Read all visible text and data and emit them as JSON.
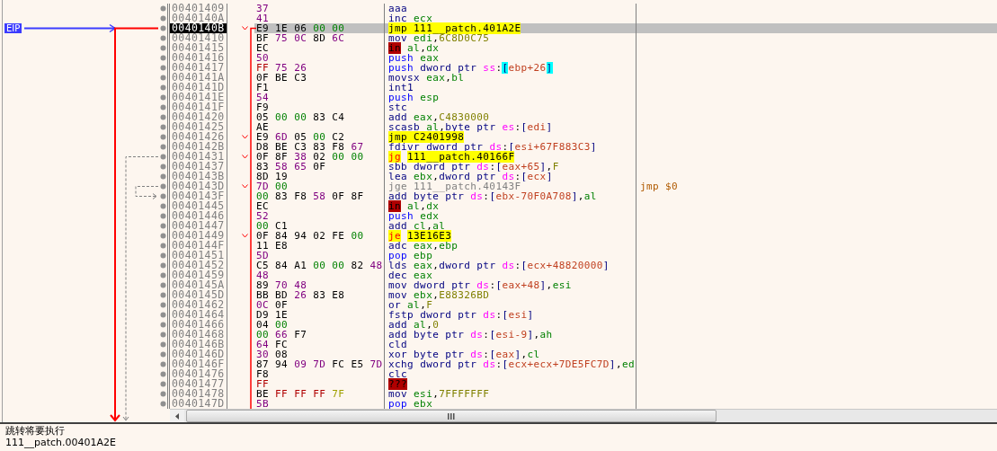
{
  "gutter": {
    "eip_label": "EIP"
  },
  "rows": [
    {
      "address": "00401409",
      "bytes": [
        {
          "text": "37",
          "kind": "p"
        }
      ],
      "branch": false,
      "selected": false,
      "instruction": [
        {
          "text": "aaa",
          "kind": "mn"
        }
      ]
    },
    {
      "address": "0040140A",
      "bytes": [
        {
          "text": "41",
          "kind": "p"
        }
      ],
      "branch": false,
      "selected": false,
      "instruction": [
        {
          "text": "inc ",
          "kind": "mn"
        },
        {
          "text": "ecx",
          "kind": "reg"
        }
      ]
    },
    {
      "address": "0040140B",
      "bytes": [
        {
          "text": "E9",
          "kind": "n"
        },
        {
          "text": "1E",
          "kind": "n"
        },
        {
          "text": "06",
          "kind": "n"
        },
        {
          "text": "00",
          "kind": "z"
        },
        {
          "text": "00",
          "kind": "z"
        }
      ],
      "branch": true,
      "selected": true,
      "instruction": [
        {
          "text": "jmp ",
          "kind": "jmp"
        },
        {
          "text": "111__patch.401A2E",
          "kind": "target"
        }
      ]
    },
    {
      "address": "00401410",
      "bytes": [
        {
          "text": "BF",
          "kind": "n"
        },
        {
          "text": "75",
          "kind": "p"
        },
        {
          "text": "0C",
          "kind": "p"
        },
        {
          "text": "8D",
          "kind": "n"
        },
        {
          "text": "6C",
          "kind": "p"
        }
      ],
      "branch": false,
      "selected": false,
      "instruction": [
        {
          "text": "mov ",
          "kind": "mn"
        },
        {
          "text": "edi",
          "kind": "reg"
        },
        {
          "text": ",",
          "kind": "punct"
        },
        {
          "text": "6C8D0C75",
          "kind": "imm"
        }
      ]
    },
    {
      "address": "00401415",
      "bytes": [
        {
          "text": "EC",
          "kind": "n"
        }
      ],
      "branch": false,
      "selected": false,
      "instruction": [
        {
          "text": "in",
          "kind": "bad"
        },
        {
          "text": "al",
          "kind": "reg"
        },
        {
          "text": ",",
          "kind": "punct"
        },
        {
          "text": "dx",
          "kind": "reg"
        }
      ]
    },
    {
      "address": "00401416",
      "bytes": [
        {
          "text": "50",
          "kind": "p"
        }
      ],
      "branch": false,
      "selected": false,
      "instruction": [
        {
          "text": "push ",
          "kind": "stack"
        },
        {
          "text": "eax",
          "kind": "reg"
        }
      ]
    },
    {
      "address": "00401417",
      "bytes": [
        {
          "text": "FF",
          "kind": "f"
        },
        {
          "text": "75",
          "kind": "p"
        },
        {
          "text": "26",
          "kind": "p"
        }
      ],
      "branch": false,
      "selected": false,
      "instruction": [
        {
          "text": "push ",
          "kind": "stack"
        },
        {
          "text": "dword ptr ",
          "kind": "size"
        },
        {
          "text": "ss",
          "kind": "seg"
        },
        {
          "text": ":",
          "kind": "punct"
        },
        {
          "text": "[",
          "kind": "hl"
        },
        {
          "text": "ebp+26",
          "kind": "mem"
        },
        {
          "text": "]",
          "kind": "hl"
        }
      ]
    },
    {
      "address": "0040141A",
      "bytes": [
        {
          "text": "0F",
          "kind": "n"
        },
        {
          "text": "BE",
          "kind": "n"
        },
        {
          "text": "C3",
          "kind": "n"
        }
      ],
      "branch": false,
      "selected": false,
      "instruction": [
        {
          "text": "movsx ",
          "kind": "mn"
        },
        {
          "text": "eax",
          "kind": "reg"
        },
        {
          "text": ",",
          "kind": "punct"
        },
        {
          "text": "bl",
          "kind": "reg"
        }
      ]
    },
    {
      "address": "0040141D",
      "bytes": [
        {
          "text": "F1",
          "kind": "n"
        }
      ],
      "branch": false,
      "selected": false,
      "instruction": [
        {
          "text": "int1",
          "kind": "mn"
        }
      ]
    },
    {
      "address": "0040141E",
      "bytes": [
        {
          "text": "54",
          "kind": "p"
        }
      ],
      "branch": false,
      "selected": false,
      "instruction": [
        {
          "text": "push ",
          "kind": "stack"
        },
        {
          "text": "esp",
          "kind": "reg"
        }
      ]
    },
    {
      "address": "0040141F",
      "bytes": [
        {
          "text": "F9",
          "kind": "n"
        }
      ],
      "branch": false,
      "selected": false,
      "instruction": [
        {
          "text": "stc",
          "kind": "mn"
        }
      ]
    },
    {
      "address": "00401420",
      "bytes": [
        {
          "text": "05",
          "kind": "n"
        },
        {
          "text": "00",
          "kind": "z"
        },
        {
          "text": "00",
          "kind": "z"
        },
        {
          "text": "83",
          "kind": "n"
        },
        {
          "text": "C4",
          "kind": "n"
        }
      ],
      "branch": false,
      "selected": false,
      "instruction": [
        {
          "text": "add ",
          "kind": "mn"
        },
        {
          "text": "eax",
          "kind": "reg"
        },
        {
          "text": ",",
          "kind": "punct"
        },
        {
          "text": "C4830000",
          "kind": "imm"
        }
      ]
    },
    {
      "address": "00401425",
      "bytes": [
        {
          "text": "AE",
          "kind": "n"
        }
      ],
      "branch": false,
      "selected": false,
      "instruction": [
        {
          "text": "scasb ",
          "kind": "mn"
        },
        {
          "text": "al",
          "kind": "reg"
        },
        {
          "text": ",",
          "kind": "punct"
        },
        {
          "text": "byte ptr ",
          "kind": "size"
        },
        {
          "text": "es",
          "kind": "seg"
        },
        {
          "text": ":",
          "kind": "punct"
        },
        {
          "text": "[",
          "kind": "bracket"
        },
        {
          "text": "edi",
          "kind": "mem"
        },
        {
          "text": "]",
          "kind": "bracket"
        }
      ]
    },
    {
      "address": "00401426",
      "bytes": [
        {
          "text": "E9",
          "kind": "n"
        },
        {
          "text": "6D",
          "kind": "p"
        },
        {
          "text": "05",
          "kind": "n"
        },
        {
          "text": "00",
          "kind": "z"
        },
        {
          "text": "C2",
          "kind": "n"
        }
      ],
      "branch": true,
      "selected": false,
      "instruction": [
        {
          "text": "jmp ",
          "kind": "jmp"
        },
        {
          "text": "C2401998",
          "kind": "target"
        }
      ]
    },
    {
      "address": "0040142B",
      "bytes": [
        {
          "text": "D8",
          "kind": "n"
        },
        {
          "text": "BE",
          "kind": "n"
        },
        {
          "text": "C3",
          "kind": "n"
        },
        {
          "text": "83",
          "kind": "n"
        },
        {
          "text": "F8",
          "kind": "n"
        },
        {
          "text": "67",
          "kind": "p"
        }
      ],
      "branch": false,
      "selected": false,
      "instruction": [
        {
          "text": "fdivr ",
          "kind": "mn"
        },
        {
          "text": "dword ptr ",
          "kind": "size"
        },
        {
          "text": "ds",
          "kind": "seg"
        },
        {
          "text": ":",
          "kind": "punct"
        },
        {
          "text": "[",
          "kind": "bracket"
        },
        {
          "text": "esi+67F883C3",
          "kind": "mem"
        },
        {
          "text": "]",
          "kind": "bracket"
        }
      ]
    },
    {
      "address": "00401431",
      "bytes": [
        {
          "text": "0F",
          "kind": "n"
        },
        {
          "text": "8F",
          "kind": "n"
        },
        {
          "text": "38",
          "kind": "p"
        },
        {
          "text": "02",
          "kind": "n"
        },
        {
          "text": "00",
          "kind": "z"
        },
        {
          "text": "00",
          "kind": "z"
        }
      ],
      "branch": true,
      "selected": false,
      "instruction": [
        {
          "text": "jg",
          "kind": "jcc"
        },
        {
          "text": "111__patch.40166F",
          "kind": "target"
        }
      ]
    },
    {
      "address": "00401437",
      "bytes": [
        {
          "text": "83",
          "kind": "n"
        },
        {
          "text": "58",
          "kind": "p"
        },
        {
          "text": "65",
          "kind": "p"
        },
        {
          "text": "0F",
          "kind": "n"
        }
      ],
      "branch": false,
      "selected": false,
      "instruction": [
        {
          "text": "sbb ",
          "kind": "mn"
        },
        {
          "text": "dword ptr ",
          "kind": "size"
        },
        {
          "text": "ds",
          "kind": "seg"
        },
        {
          "text": ":",
          "kind": "punct"
        },
        {
          "text": "[",
          "kind": "bracket"
        },
        {
          "text": "eax+65",
          "kind": "mem"
        },
        {
          "text": "]",
          "kind": "bracket"
        },
        {
          "text": ",",
          "kind": "punct"
        },
        {
          "text": "F",
          "kind": "imm"
        }
      ]
    },
    {
      "address": "0040143B",
      "bytes": [
        {
          "text": "8D",
          "kind": "n"
        },
        {
          "text": "19",
          "kind": "n"
        }
      ],
      "branch": false,
      "selected": false,
      "instruction": [
        {
          "text": "lea ",
          "kind": "mn"
        },
        {
          "text": "ebx",
          "kind": "reg"
        },
        {
          "text": ",",
          "kind": "punct"
        },
        {
          "text": "dword ptr ",
          "kind": "size"
        },
        {
          "text": "ds",
          "kind": "seg"
        },
        {
          "text": ":",
          "kind": "punct"
        },
        {
          "text": "[",
          "kind": "bracket"
        },
        {
          "text": "ecx",
          "kind": "mem"
        },
        {
          "text": "]",
          "kind": "bracket"
        }
      ]
    },
    {
      "address": "0040143D",
      "bytes": [
        {
          "text": "7D",
          "kind": "p"
        },
        {
          "text": "00",
          "kind": "z"
        }
      ],
      "branch": true,
      "selected": false,
      "instruction": [
        {
          "text": "jge 111__patch.40143F",
          "kind": "grey"
        }
      ],
      "comment": "jmp $0"
    },
    {
      "address": "0040143F",
      "bytes": [
        {
          "text": "00",
          "kind": "z"
        },
        {
          "text": "83",
          "kind": "n"
        },
        {
          "text": "F8",
          "kind": "n"
        },
        {
          "text": "58",
          "kind": "p"
        },
        {
          "text": "0F",
          "kind": "n"
        },
        {
          "text": "8F",
          "kind": "n"
        }
      ],
      "branch": false,
      "selected": false,
      "instruction": [
        {
          "text": "add ",
          "kind": "mn"
        },
        {
          "text": "byte ptr ",
          "kind": "size"
        },
        {
          "text": "ds",
          "kind": "seg"
        },
        {
          "text": ":",
          "kind": "punct"
        },
        {
          "text": "[",
          "kind": "bracket"
        },
        {
          "text": "ebx-70F0A708",
          "kind": "mem"
        },
        {
          "text": "]",
          "kind": "bracket"
        },
        {
          "text": ",",
          "kind": "punct"
        },
        {
          "text": "al",
          "kind": "reg"
        }
      ]
    },
    {
      "address": "00401445",
      "bytes": [
        {
          "text": "EC",
          "kind": "n"
        }
      ],
      "branch": false,
      "selected": false,
      "instruction": [
        {
          "text": "in",
          "kind": "bad"
        },
        {
          "text": "al",
          "kind": "reg"
        },
        {
          "text": ",",
          "kind": "punct"
        },
        {
          "text": "dx",
          "kind": "reg"
        }
      ]
    },
    {
      "address": "00401446",
      "bytes": [
        {
          "text": "52",
          "kind": "p"
        }
      ],
      "branch": false,
      "selected": false,
      "instruction": [
        {
          "text": "push ",
          "kind": "stack"
        },
        {
          "text": "edx",
          "kind": "reg"
        }
      ]
    },
    {
      "address": "00401447",
      "bytes": [
        {
          "text": "00",
          "kind": "z"
        },
        {
          "text": "C1",
          "kind": "n"
        }
      ],
      "branch": false,
      "selected": false,
      "instruction": [
        {
          "text": "add ",
          "kind": "mn"
        },
        {
          "text": "cl",
          "kind": "reg"
        },
        {
          "text": ",",
          "kind": "punct"
        },
        {
          "text": "al",
          "kind": "reg"
        }
      ]
    },
    {
      "address": "00401449",
      "bytes": [
        {
          "text": "0F",
          "kind": "n"
        },
        {
          "text": "84",
          "kind": "n"
        },
        {
          "text": "94",
          "kind": "n"
        },
        {
          "text": "02",
          "kind": "n"
        },
        {
          "text": "FE",
          "kind": "n"
        },
        {
          "text": "00",
          "kind": "z"
        }
      ],
      "branch": true,
      "selected": false,
      "instruction": [
        {
          "text": "je",
          "kind": "jcc"
        },
        {
          "text": "13E16E3",
          "kind": "target"
        }
      ]
    },
    {
      "address": "0040144F",
      "bytes": [
        {
          "text": "11",
          "kind": "n"
        },
        {
          "text": "E8",
          "kind": "n"
        }
      ],
      "branch": false,
      "selected": false,
      "instruction": [
        {
          "text": "adc ",
          "kind": "mn"
        },
        {
          "text": "eax",
          "kind": "reg"
        },
        {
          "text": ",",
          "kind": "punct"
        },
        {
          "text": "ebp",
          "kind": "reg"
        }
      ]
    },
    {
      "address": "00401451",
      "bytes": [
        {
          "text": "5D",
          "kind": "p"
        }
      ],
      "branch": false,
      "selected": false,
      "instruction": [
        {
          "text": "pop ",
          "kind": "stack"
        },
        {
          "text": "ebp",
          "kind": "reg"
        }
      ]
    },
    {
      "address": "00401452",
      "bytes": [
        {
          "text": "C5",
          "kind": "n"
        },
        {
          "text": "84",
          "kind": "n"
        },
        {
          "text": "A1",
          "kind": "n"
        },
        {
          "text": "00",
          "kind": "z"
        },
        {
          "text": "00",
          "kind": "z"
        },
        {
          "text": "82",
          "kind": "n"
        },
        {
          "text": "48",
          "kind": "p"
        }
      ],
      "branch": false,
      "selected": false,
      "instruction": [
        {
          "text": "lds ",
          "kind": "mn"
        },
        {
          "text": "eax",
          "kind": "reg"
        },
        {
          "text": ",",
          "kind": "punct"
        },
        {
          "text": "dword ptr ",
          "kind": "size"
        },
        {
          "text": "ds",
          "kind": "seg"
        },
        {
          "text": ":",
          "kind": "punct"
        },
        {
          "text": "[",
          "kind": "bracket"
        },
        {
          "text": "ecx+48820000",
          "kind": "mem"
        },
        {
          "text": "]",
          "kind": "bracket"
        }
      ]
    },
    {
      "address": "00401459",
      "bytes": [
        {
          "text": "48",
          "kind": "p"
        }
      ],
      "branch": false,
      "selected": false,
      "instruction": [
        {
          "text": "dec ",
          "kind": "mn"
        },
        {
          "text": "eax",
          "kind": "reg"
        }
      ]
    },
    {
      "address": "0040145A",
      "bytes": [
        {
          "text": "89",
          "kind": "n"
        },
        {
          "text": "70",
          "kind": "p"
        },
        {
          "text": "48",
          "kind": "p"
        }
      ],
      "branch": false,
      "selected": false,
      "instruction": [
        {
          "text": "mov ",
          "kind": "mn"
        },
        {
          "text": "dword ptr ",
          "kind": "size"
        },
        {
          "text": "ds",
          "kind": "seg"
        },
        {
          "text": ":",
          "kind": "punct"
        },
        {
          "text": "[",
          "kind": "bracket"
        },
        {
          "text": "eax+48",
          "kind": "mem"
        },
        {
          "text": "]",
          "kind": "bracket"
        },
        {
          "text": ",",
          "kind": "punct"
        },
        {
          "text": "esi",
          "kind": "reg"
        }
      ]
    },
    {
      "address": "0040145D",
      "bytes": [
        {
          "text": "BB",
          "kind": "n"
        },
        {
          "text": "BD",
          "kind": "n"
        },
        {
          "text": "26",
          "kind": "p"
        },
        {
          "text": "83",
          "kind": "n"
        },
        {
          "text": "E8",
          "kind": "n"
        }
      ],
      "branch": false,
      "selected": false,
      "instruction": [
        {
          "text": "mov ",
          "kind": "mn"
        },
        {
          "text": "ebx",
          "kind": "reg"
        },
        {
          "text": ",",
          "kind": "punct"
        },
        {
          "text": "E88326BD",
          "kind": "imm"
        }
      ]
    },
    {
      "address": "00401462",
      "bytes": [
        {
          "text": "0C",
          "kind": "p"
        },
        {
          "text": "0F",
          "kind": "n"
        }
      ],
      "branch": false,
      "selected": false,
      "instruction": [
        {
          "text": "or ",
          "kind": "mn"
        },
        {
          "text": "al",
          "kind": "reg"
        },
        {
          "text": ",",
          "kind": "punct"
        },
        {
          "text": "F",
          "kind": "imm"
        }
      ]
    },
    {
      "address": "00401464",
      "bytes": [
        {
          "text": "D9",
          "kind": "n"
        },
        {
          "text": "1E",
          "kind": "n"
        }
      ],
      "branch": false,
      "selected": false,
      "instruction": [
        {
          "text": "fstp ",
          "kind": "mn"
        },
        {
          "text": "dword ptr ",
          "kind": "size"
        },
        {
          "text": "ds",
          "kind": "seg"
        },
        {
          "text": ":",
          "kind": "punct"
        },
        {
          "text": "[",
          "kind": "bracket"
        },
        {
          "text": "esi",
          "kind": "mem"
        },
        {
          "text": "]",
          "kind": "bracket"
        }
      ]
    },
    {
      "address": "00401466",
      "bytes": [
        {
          "text": "04",
          "kind": "n"
        },
        {
          "text": "00",
          "kind": "z"
        }
      ],
      "branch": false,
      "selected": false,
      "instruction": [
        {
          "text": "add ",
          "kind": "mn"
        },
        {
          "text": "al",
          "kind": "reg"
        },
        {
          "text": ",",
          "kind": "punct"
        },
        {
          "text": "0",
          "kind": "imm"
        }
      ]
    },
    {
      "address": "00401468",
      "bytes": [
        {
          "text": "00",
          "kind": "z"
        },
        {
          "text": "66",
          "kind": "p"
        },
        {
          "text": "F7",
          "kind": "n"
        }
      ],
      "branch": false,
      "selected": false,
      "instruction": [
        {
          "text": "add ",
          "kind": "mn"
        },
        {
          "text": "byte ptr ",
          "kind": "size"
        },
        {
          "text": "ds",
          "kind": "seg"
        },
        {
          "text": ":",
          "kind": "punct"
        },
        {
          "text": "[",
          "kind": "bracket"
        },
        {
          "text": "esi-9",
          "kind": "mem"
        },
        {
          "text": "]",
          "kind": "bracket"
        },
        {
          "text": ",",
          "kind": "punct"
        },
        {
          "text": "ah",
          "kind": "reg"
        }
      ]
    },
    {
      "address": "0040146B",
      "bytes": [
        {
          "text": "64",
          "kind": "p"
        },
        {
          "text": "FC",
          "kind": "n"
        }
      ],
      "branch": false,
      "selected": false,
      "instruction": [
        {
          "text": "cld",
          "kind": "mn"
        }
      ]
    },
    {
      "address": "0040146D",
      "bytes": [
        {
          "text": "30",
          "kind": "p"
        },
        {
          "text": "08",
          "kind": "n"
        }
      ],
      "branch": false,
      "selected": false,
      "instruction": [
        {
          "text": "xor ",
          "kind": "mn"
        },
        {
          "text": "byte ptr ",
          "kind": "size"
        },
        {
          "text": "ds",
          "kind": "seg"
        },
        {
          "text": ":",
          "kind": "punct"
        },
        {
          "text": "[",
          "kind": "bracket"
        },
        {
          "text": "eax",
          "kind": "mem"
        },
        {
          "text": "]",
          "kind": "bracket"
        },
        {
          "text": ",",
          "kind": "punct"
        },
        {
          "text": "cl",
          "kind": "reg"
        }
      ]
    },
    {
      "address": "0040146F",
      "bytes": [
        {
          "text": "87",
          "kind": "n"
        },
        {
          "text": "94",
          "kind": "n"
        },
        {
          "text": "09",
          "kind": "p"
        },
        {
          "text": "7D",
          "kind": "p"
        },
        {
          "text": "FC",
          "kind": "n"
        },
        {
          "text": "E5",
          "kind": "n"
        },
        {
          "text": "7D",
          "kind": "p"
        }
      ],
      "branch": false,
      "selected": false,
      "instruction": [
        {
          "text": "xchg ",
          "kind": "mn"
        },
        {
          "text": "dword ptr ",
          "kind": "size"
        },
        {
          "text": "ds",
          "kind": "seg"
        },
        {
          "text": ":",
          "kind": "punct"
        },
        {
          "text": "[",
          "kind": "bracket"
        },
        {
          "text": "ecx+ecx+7DE5FC7D",
          "kind": "mem"
        },
        {
          "text": "]",
          "kind": "bracket"
        },
        {
          "text": ",",
          "kind": "punct"
        },
        {
          "text": "ed",
          "kind": "reg"
        }
      ]
    },
    {
      "address": "00401476",
      "bytes": [
        {
          "text": "F8",
          "kind": "n"
        }
      ],
      "branch": false,
      "selected": false,
      "instruction": [
        {
          "text": "clc",
          "kind": "mn"
        }
      ]
    },
    {
      "address": "00401477",
      "bytes": [
        {
          "text": "FF",
          "kind": "f"
        }
      ],
      "branch": false,
      "selected": false,
      "instruction": [
        {
          "text": "???",
          "kind": "bad"
        }
      ]
    },
    {
      "address": "00401478",
      "bytes": [
        {
          "text": "BE",
          "kind": "n"
        },
        {
          "text": "FF",
          "kind": "f"
        },
        {
          "text": "FF",
          "kind": "f"
        },
        {
          "text": "FF",
          "kind": "f"
        },
        {
          "text": "7F",
          "kind": "y"
        }
      ],
      "branch": false,
      "selected": false,
      "instruction": [
        {
          "text": "mov ",
          "kind": "mn"
        },
        {
          "text": "esi",
          "kind": "reg"
        },
        {
          "text": ",",
          "kind": "punct"
        },
        {
          "text": "7FFFFFFF",
          "kind": "imm"
        }
      ]
    },
    {
      "address": "0040147D",
      "bytes": [
        {
          "text": "5B",
          "kind": "p"
        }
      ],
      "branch": false,
      "selected": false,
      "instruction": [
        {
          "text": "pop ",
          "kind": "stack"
        },
        {
          "text": "ebx",
          "kind": "reg"
        }
      ]
    }
  ],
  "info_pane": {
    "lines": [
      "跳转将要执行",
      "111__patch.00401A2E"
    ]
  }
}
